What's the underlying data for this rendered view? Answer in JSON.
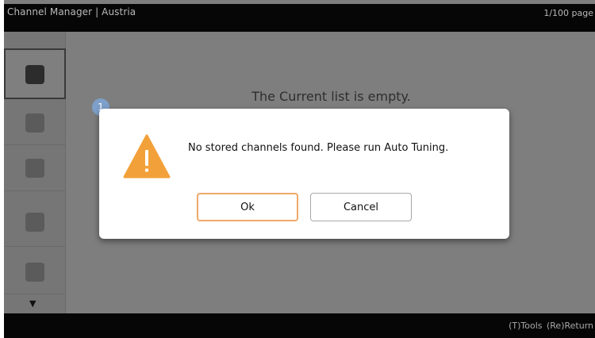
{
  "header": {
    "title": "Channel Manager | Austria",
    "page_indicator": "1/100 page"
  },
  "content": {
    "empty_message": "The Current list is empty."
  },
  "sidebar": {
    "scroll_down_glyph": "▼"
  },
  "callout": {
    "number": "1"
  },
  "dialog": {
    "icon": "warning-icon",
    "message": "No stored channels found. Please run Auto Tuning.",
    "ok_label": "Ok",
    "cancel_label": "Cancel"
  },
  "footer": {
    "hints": "(T)Tools (Re)Return"
  },
  "colors": {
    "warning_orange": "#f2a13a",
    "ok_button_border": "#f0a86a",
    "callout_blue": "#7d9fc9"
  }
}
